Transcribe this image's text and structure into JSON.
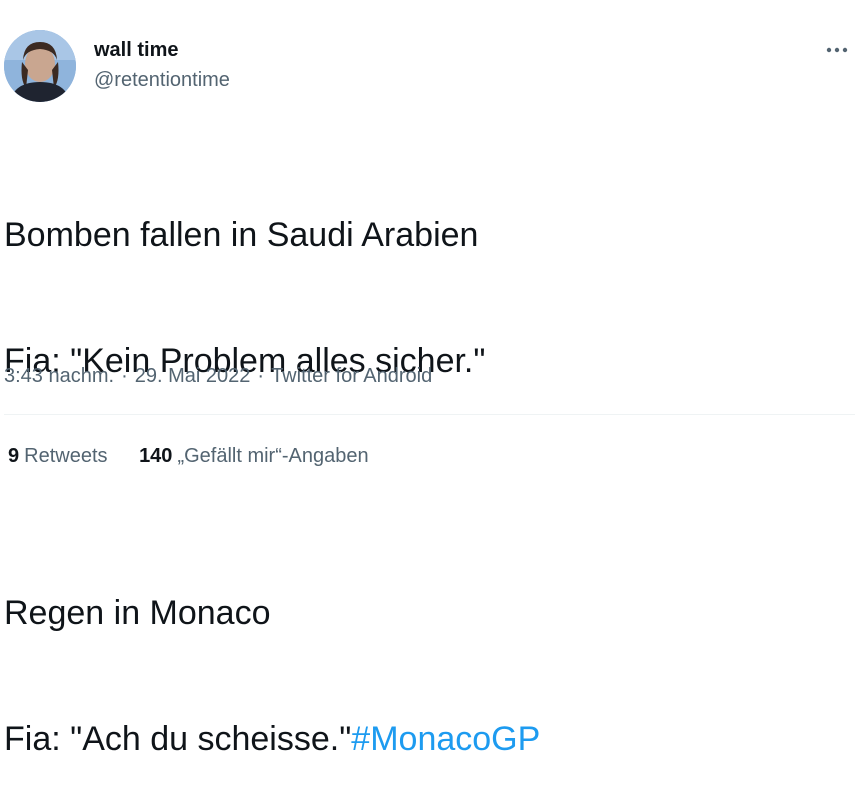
{
  "author": {
    "display_name": "wall time",
    "handle": "@retentiontime"
  },
  "tweet": {
    "lines": [
      "Bomben fallen in Saudi Arabien",
      "Fia: \"Kein Problem alles sicher.\"",
      "",
      "Regen in Monaco"
    ],
    "last_line_text": "Fia: \"Ach du scheisse.\"",
    "hashtag": "#MonacoGP"
  },
  "meta": {
    "time": "3:43 nachm.",
    "separator": "·",
    "date": "29. Mai 2022",
    "source": "Twitter for Android"
  },
  "stats": {
    "retweets_count": "9",
    "retweets_label": "Retweets",
    "likes_count": "140",
    "likes_label": "„Gefällt mir“-Angaben"
  },
  "icons": {
    "more": "more-horizontal-icon"
  },
  "colors": {
    "text": "#0f1419",
    "secondary": "#536471",
    "link": "#1d9bf0",
    "divider": "#eff3f4"
  }
}
